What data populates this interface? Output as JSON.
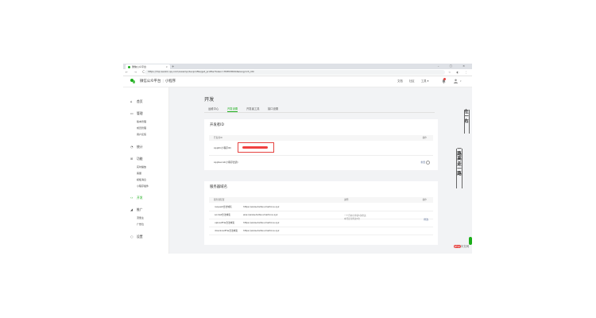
{
  "browser": {
    "tab_title": "微信公众平台",
    "tab_close": "×",
    "new_tab": "+",
    "window_controls": "–  ▢  ×",
    "nav_buttons": "← → C",
    "url": "https://mp.weixin.qq.com/wxamp/devprofile/get_profile?token=358538094&lang=zh_CN",
    "addr_right_icons": "☆  ◐  ⋮"
  },
  "header": {
    "brand": "微信公众平台",
    "product": "小程序",
    "nav": [
      "文档",
      "社区",
      "工具 ▾"
    ],
    "avatar_caret": "▾"
  },
  "sidebar": {
    "items": [
      {
        "label": "首页",
        "icon": "home-icon",
        "glyph": "⌂"
      },
      {
        "label": "管理",
        "icon": "manage-icon",
        "glyph": "▭"
      },
      {
        "label": "统计",
        "icon": "stats-icon",
        "glyph": "◔"
      },
      {
        "label": "功能",
        "icon": "function-icon",
        "glyph": "⊞"
      },
      {
        "label": "开发",
        "icon": "dev-icon",
        "glyph": "‹›"
      },
      {
        "label": "推广",
        "icon": "promote-icon",
        "glyph": "◢"
      },
      {
        "label": "设置",
        "icon": "settings-icon",
        "glyph": "○"
      }
    ],
    "manage_sub": [
      "版本管理",
      "成员管理",
      "用户反馈"
    ],
    "function_sub": [
      "实时播放",
      "客服",
      "模板消息",
      "小程序插件"
    ],
    "promote_sub": [
      "流量主",
      "广告位"
    ]
  },
  "main": {
    "title": "开发",
    "tabs": [
      "运维中心",
      "开发设置",
      "开发者工具",
      "接口设置"
    ],
    "active_tab": 1
  },
  "dev_id": {
    "title": "开发者ID",
    "header_left": "开发者ID",
    "header_right": "操作",
    "appid_label": "AppID(小程序ID)",
    "secret_label": "AppSecret(小程序密钥)",
    "reset_link": "重置"
  },
  "server_domains": {
    "title": "服务器域名",
    "header_cols": [
      "服务器配置",
      "说明",
      "操作"
    ],
    "rows": [
      {
        "name": "request合法域名",
        "value": "https://www.daitai-smartone.xyz"
      },
      {
        "name": "socket合法域名",
        "value": "wss://www.daitai-smartone.xyz"
      },
      {
        "name": "uploadFile合法域名",
        "value": "https://www.daitai-smartone.xyz"
      },
      {
        "name": "downloadFile合法域名",
        "value": "https://www.daitai-smartone.xyz"
      }
    ],
    "note_line1": "一个月内可申请5次修改",
    "note_line2": "本月还可修改5次",
    "action": "修改"
  },
  "right_margin": {
    "text_a": "左一右",
    "text_b": "一路高走一路"
  },
  "watermark": {
    "brand": "php",
    "site": "中文网"
  },
  "colors": {
    "accent": "#1aad19",
    "danger": "#e64340",
    "link": "#576b95"
  }
}
